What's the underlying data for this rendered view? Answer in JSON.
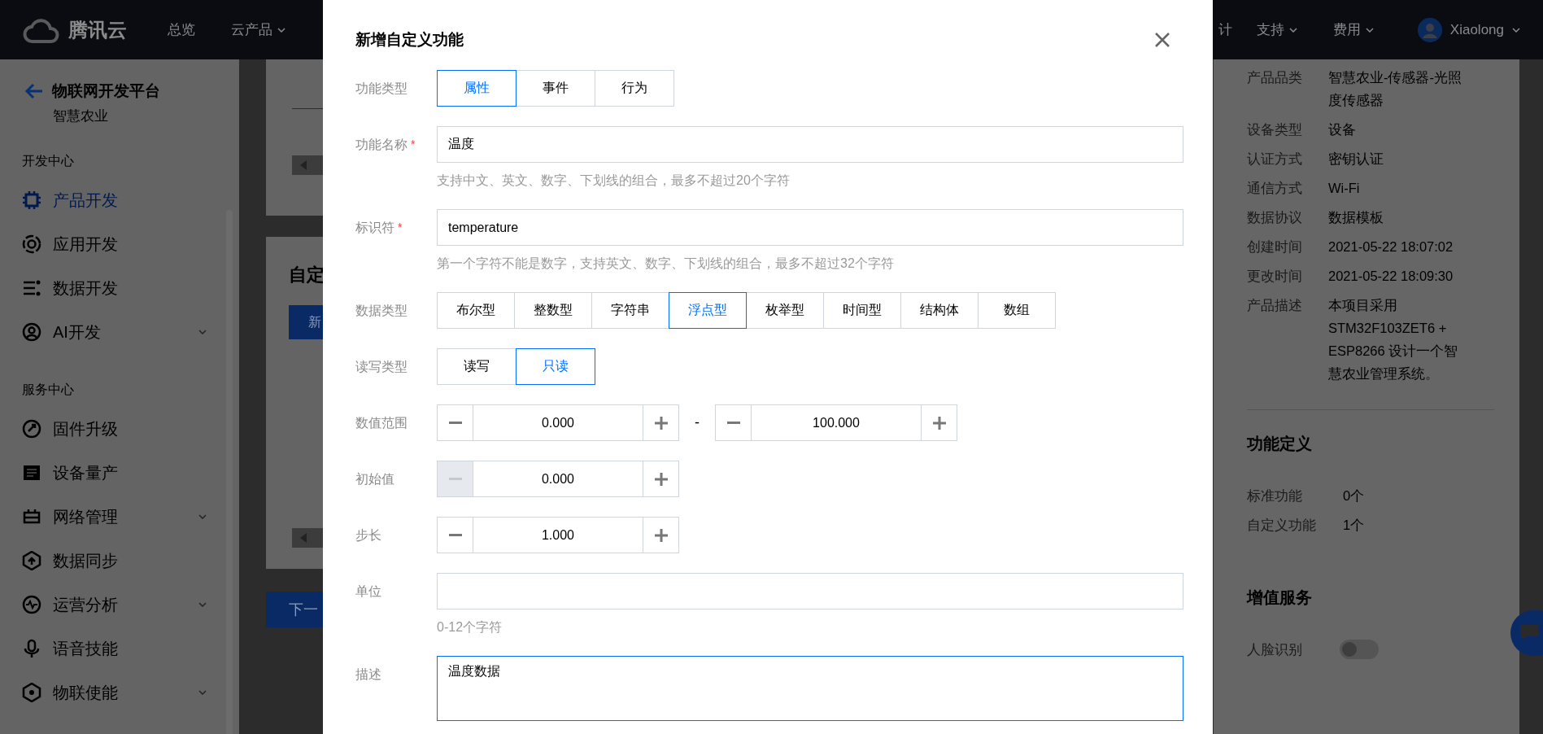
{
  "header": {
    "logo_text": "腾讯云",
    "nav": [
      {
        "label": "总览",
        "dropdown": false
      },
      {
        "label": "云产品",
        "dropdown": true
      }
    ],
    "nav_right": [
      {
        "label": "计",
        "dropdown": false
      },
      {
        "label": "支持",
        "dropdown": true
      },
      {
        "label": "费用",
        "dropdown": true
      }
    ],
    "user": {
      "name": "Xiaolong"
    }
  },
  "sidebar": {
    "title": "物联网开发平台",
    "subtitle": "智慧农业",
    "sections": [
      {
        "heading": "开发中心",
        "items": [
          {
            "label": "产品开发",
            "selected": true,
            "expandable": false
          },
          {
            "label": "应用开发",
            "selected": false,
            "expandable": false
          },
          {
            "label": "数据开发",
            "selected": false,
            "expandable": false
          },
          {
            "label": "AI开发",
            "selected": false,
            "expandable": true
          }
        ]
      },
      {
        "heading": "服务中心",
        "items": [
          {
            "label": "固件升级",
            "selected": false,
            "expandable": false
          },
          {
            "label": "设备量产",
            "selected": false,
            "expandable": false
          },
          {
            "label": "网络管理",
            "selected": false,
            "expandable": true
          },
          {
            "label": "数据同步",
            "selected": false,
            "expandable": false
          },
          {
            "label": "运营分析",
            "selected": false,
            "expandable": true
          },
          {
            "label": "语音技能",
            "selected": false,
            "expandable": false
          },
          {
            "label": "物联使能",
            "selected": false,
            "expandable": true
          }
        ]
      }
    ]
  },
  "main": {
    "card_title": "自定",
    "add_button": "新",
    "next_button": "下一"
  },
  "detail_panel": {
    "rows": [
      {
        "label": "产品品类",
        "value": "智慧农业-传感器-光照度传感器"
      },
      {
        "label": "设备类型",
        "value": "设备"
      },
      {
        "label": "认证方式",
        "value": "密钥认证"
      },
      {
        "label": "通信方式",
        "value": "Wi-Fi"
      },
      {
        "label": "数据协议",
        "value": "数据模板"
      },
      {
        "label": "创建时间",
        "value": "2021-05-22 18:07:02"
      },
      {
        "label": "更改时间",
        "value": "2021-05-22 18:09:30"
      },
      {
        "label": "产品描述",
        "value": "本项目采用STM32F103ZET6 + ESP8266 设计一个智慧农业管理系统。"
      }
    ],
    "function_definition": {
      "title": "功能定义",
      "rows": [
        {
          "label": "标准功能",
          "value": "0个"
        },
        {
          "label": "自定义功能",
          "value": "1个"
        }
      ]
    },
    "value_added": {
      "title": "增值服务",
      "rows": [
        {
          "label": "人脸识别",
          "on": false
        }
      ]
    }
  },
  "dialog": {
    "title": "新增自定义功能",
    "fields": [
      {
        "kind": "segmented",
        "label": "功能类型",
        "options": [
          {
            "label": "属性",
            "selected": true
          },
          {
            "label": "事件",
            "selected": false
          },
          {
            "label": "行为",
            "selected": false
          }
        ]
      },
      {
        "kind": "text",
        "label": "功能名称",
        "required_mark": "*",
        "value": "温度",
        "hint": "支持中文、英文、数字、下划线的组合，最多不超过20个字符"
      },
      {
        "kind": "text",
        "label": "标识符",
        "required_mark": "*",
        "value": "temperature",
        "hint": "第一个字符不能是数字，支持英文、数字、下划线的组合，最多不超过32个字符"
      },
      {
        "kind": "segmented",
        "label": "数据类型",
        "options": [
          {
            "label": "布尔型",
            "selected": false
          },
          {
            "label": "整数型",
            "selected": false
          },
          {
            "label": "字符串",
            "selected": false
          },
          {
            "label": "浮点型",
            "selected": true
          },
          {
            "label": "枚举型",
            "selected": false
          },
          {
            "label": "时间型",
            "selected": false
          },
          {
            "label": "结构体",
            "selected": false
          },
          {
            "label": "数组",
            "selected": false
          }
        ]
      },
      {
        "kind": "segmented",
        "label": "读写类型",
        "options": [
          {
            "label": "读写",
            "selected": false
          },
          {
            "label": "只读",
            "selected": true
          }
        ]
      },
      {
        "kind": "range",
        "label": "数值范围",
        "separator": "-",
        "steppers": [
          {
            "value": "0.000",
            "minus_disabled": false
          },
          {
            "value": "100.000",
            "minus_disabled": false
          }
        ]
      },
      {
        "kind": "range",
        "label": "初始值",
        "steppers": [
          {
            "value": "0.000",
            "minus_disabled": true
          }
        ]
      },
      {
        "kind": "range",
        "label": "步长",
        "steppers": [
          {
            "value": "1.000",
            "minus_disabled": false
          }
        ]
      },
      {
        "kind": "text",
        "label": "单位",
        "hint": "0-12个字符"
      },
      {
        "kind": "textarea",
        "label": "描述",
        "value": "温度数据",
        "focused": true
      }
    ]
  }
}
